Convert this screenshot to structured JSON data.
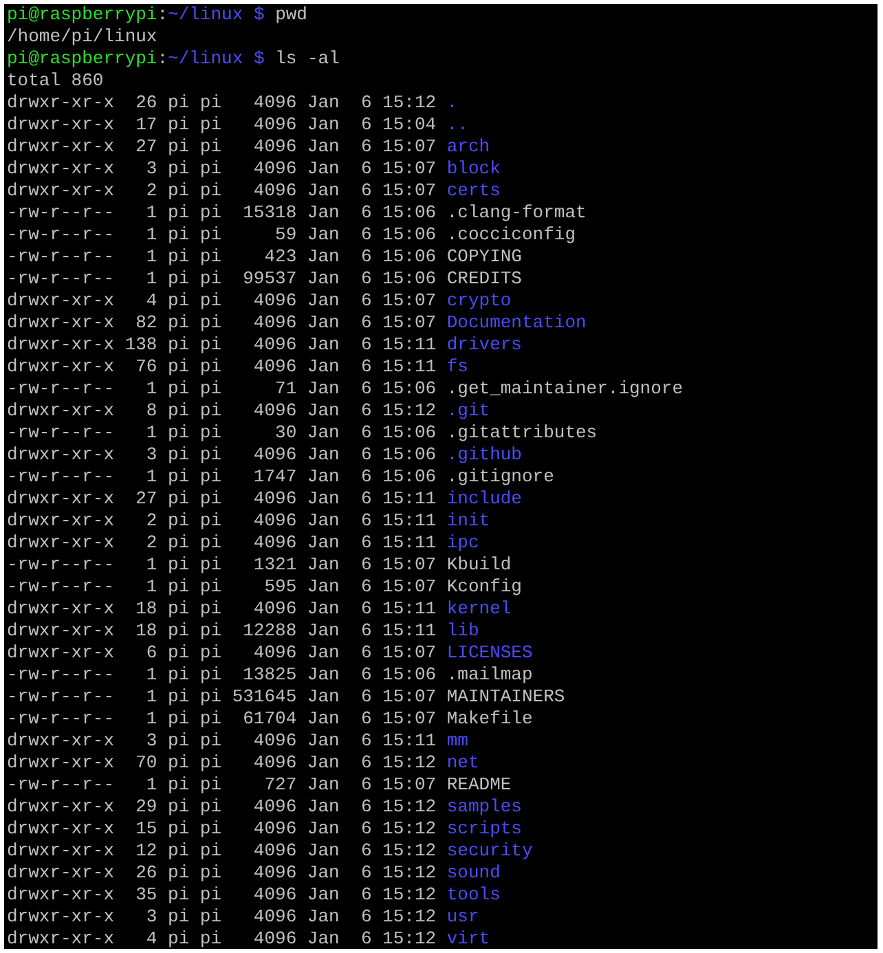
{
  "terminal": {
    "lines": [
      {
        "kind": "prompt",
        "user_host": "pi@raspberrypi",
        "separator": ":",
        "path": "~/linux $",
        "command": "pwd"
      },
      {
        "kind": "output",
        "text": "/home/pi/linux"
      },
      {
        "kind": "prompt",
        "user_host": "pi@raspberrypi",
        "separator": ":",
        "path": "~/linux $",
        "command": "ls -al"
      },
      {
        "kind": "output",
        "text": "total 860"
      },
      {
        "kind": "entry",
        "info": "drwxr-xr-x  26 pi pi   4096 Jan  6 15:12",
        "name": ".",
        "directory": true
      },
      {
        "kind": "entry",
        "info": "drwxr-xr-x  17 pi pi   4096 Jan  6 15:04",
        "name": "..",
        "directory": true
      },
      {
        "kind": "entry",
        "info": "drwxr-xr-x  27 pi pi   4096 Jan  6 15:07",
        "name": "arch",
        "directory": true
      },
      {
        "kind": "entry",
        "info": "drwxr-xr-x   3 pi pi   4096 Jan  6 15:07",
        "name": "block",
        "directory": true
      },
      {
        "kind": "entry",
        "info": "drwxr-xr-x   2 pi pi   4096 Jan  6 15:07",
        "name": "certs",
        "directory": true
      },
      {
        "kind": "entry",
        "info": "-rw-r--r--   1 pi pi  15318 Jan  6 15:06",
        "name": ".clang-format",
        "directory": false
      },
      {
        "kind": "entry",
        "info": "-rw-r--r--   1 pi pi     59 Jan  6 15:06",
        "name": ".cocciconfig",
        "directory": false
      },
      {
        "kind": "entry",
        "info": "-rw-r--r--   1 pi pi    423 Jan  6 15:06",
        "name": "COPYING",
        "directory": false
      },
      {
        "kind": "entry",
        "info": "-rw-r--r--   1 pi pi  99537 Jan  6 15:06",
        "name": "CREDITS",
        "directory": false
      },
      {
        "kind": "entry",
        "info": "drwxr-xr-x   4 pi pi   4096 Jan  6 15:07",
        "name": "crypto",
        "directory": true
      },
      {
        "kind": "entry",
        "info": "drwxr-xr-x  82 pi pi   4096 Jan  6 15:07",
        "name": "Documentation",
        "directory": true
      },
      {
        "kind": "entry",
        "info": "drwxr-xr-x 138 pi pi   4096 Jan  6 15:11",
        "name": "drivers",
        "directory": true
      },
      {
        "kind": "entry",
        "info": "drwxr-xr-x  76 pi pi   4096 Jan  6 15:11",
        "name": "fs",
        "directory": true
      },
      {
        "kind": "entry",
        "info": "-rw-r--r--   1 pi pi     71 Jan  6 15:06",
        "name": ".get_maintainer.ignore",
        "directory": false
      },
      {
        "kind": "entry",
        "info": "drwxr-xr-x   8 pi pi   4096 Jan  6 15:12",
        "name": ".git",
        "directory": true
      },
      {
        "kind": "entry",
        "info": "-rw-r--r--   1 pi pi     30 Jan  6 15:06",
        "name": ".gitattributes",
        "directory": false
      },
      {
        "kind": "entry",
        "info": "drwxr-xr-x   3 pi pi   4096 Jan  6 15:06",
        "name": ".github",
        "directory": true
      },
      {
        "kind": "entry",
        "info": "-rw-r--r--   1 pi pi   1747 Jan  6 15:06",
        "name": ".gitignore",
        "directory": false
      },
      {
        "kind": "entry",
        "info": "drwxr-xr-x  27 pi pi   4096 Jan  6 15:11",
        "name": "include",
        "directory": true
      },
      {
        "kind": "entry",
        "info": "drwxr-xr-x   2 pi pi   4096 Jan  6 15:11",
        "name": "init",
        "directory": true
      },
      {
        "kind": "entry",
        "info": "drwxr-xr-x   2 pi pi   4096 Jan  6 15:11",
        "name": "ipc",
        "directory": true
      },
      {
        "kind": "entry",
        "info": "-rw-r--r--   1 pi pi   1321 Jan  6 15:07",
        "name": "Kbuild",
        "directory": false
      },
      {
        "kind": "entry",
        "info": "-rw-r--r--   1 pi pi    595 Jan  6 15:07",
        "name": "Kconfig",
        "directory": false
      },
      {
        "kind": "entry",
        "info": "drwxr-xr-x  18 pi pi   4096 Jan  6 15:11",
        "name": "kernel",
        "directory": true
      },
      {
        "kind": "entry",
        "info": "drwxr-xr-x  18 pi pi  12288 Jan  6 15:11",
        "name": "lib",
        "directory": true
      },
      {
        "kind": "entry",
        "info": "drwxr-xr-x   6 pi pi   4096 Jan  6 15:07",
        "name": "LICENSES",
        "directory": true
      },
      {
        "kind": "entry",
        "info": "-rw-r--r--   1 pi pi  13825 Jan  6 15:06",
        "name": ".mailmap",
        "directory": false
      },
      {
        "kind": "entry",
        "info": "-rw-r--r--   1 pi pi 531645 Jan  6 15:07",
        "name": "MAINTAINERS",
        "directory": false
      },
      {
        "kind": "entry",
        "info": "-rw-r--r--   1 pi pi  61704 Jan  6 15:07",
        "name": "Makefile",
        "directory": false
      },
      {
        "kind": "entry",
        "info": "drwxr-xr-x   3 pi pi   4096 Jan  6 15:11",
        "name": "mm",
        "directory": true
      },
      {
        "kind": "entry",
        "info": "drwxr-xr-x  70 pi pi   4096 Jan  6 15:12",
        "name": "net",
        "directory": true
      },
      {
        "kind": "entry",
        "info": "-rw-r--r--   1 pi pi    727 Jan  6 15:07",
        "name": "README",
        "directory": false
      },
      {
        "kind": "entry",
        "info": "drwxr-xr-x  29 pi pi   4096 Jan  6 15:12",
        "name": "samples",
        "directory": true
      },
      {
        "kind": "entry",
        "info": "drwxr-xr-x  15 pi pi   4096 Jan  6 15:12",
        "name": "scripts",
        "directory": true
      },
      {
        "kind": "entry",
        "info": "drwxr-xr-x  12 pi pi   4096 Jan  6 15:12",
        "name": "security",
        "directory": true
      },
      {
        "kind": "entry",
        "info": "drwxr-xr-x  26 pi pi   4096 Jan  6 15:12",
        "name": "sound",
        "directory": true
      },
      {
        "kind": "entry",
        "info": "drwxr-xr-x  35 pi pi   4096 Jan  6 15:12",
        "name": "tools",
        "directory": true
      },
      {
        "kind": "entry",
        "info": "drwxr-xr-x   3 pi pi   4096 Jan  6 15:12",
        "name": "usr",
        "directory": true
      },
      {
        "kind": "entry",
        "info": "drwxr-xr-x   4 pi pi   4096 Jan  6 15:12",
        "name": "virt",
        "directory": true
      }
    ]
  }
}
